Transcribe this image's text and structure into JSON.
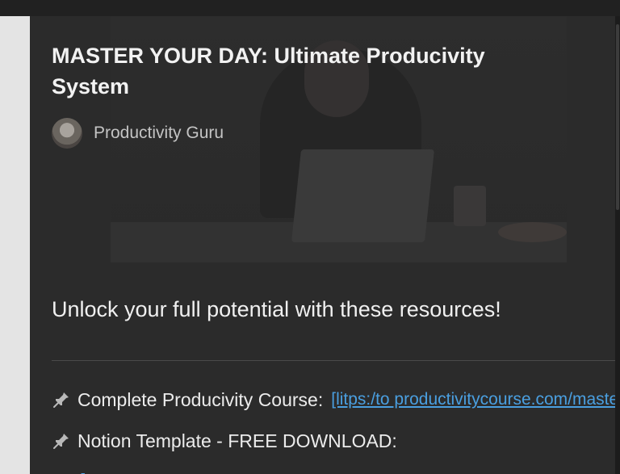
{
  "post": {
    "title": "MASTER YOUR DAY: Ultimate Producivity System",
    "author": "Productivity Guru",
    "tagline": "Unlock your full potential with these resources!"
  },
  "resources": [
    {
      "icon": "pin-icon",
      "label": "Complete Producivity Course:",
      "link": "[litps:/to productivitycourse.com/maste"
    },
    {
      "icon": "pin-icon",
      "label": "Notion Template - FREE DOWNLOAD:",
      "link": ""
    }
  ],
  "bottom_link": "[",
  "colors": {
    "panel": "#2b2b2b",
    "text": "#f2f2f2",
    "muted": "#c4c4c4",
    "link": "#4a9fe0"
  }
}
